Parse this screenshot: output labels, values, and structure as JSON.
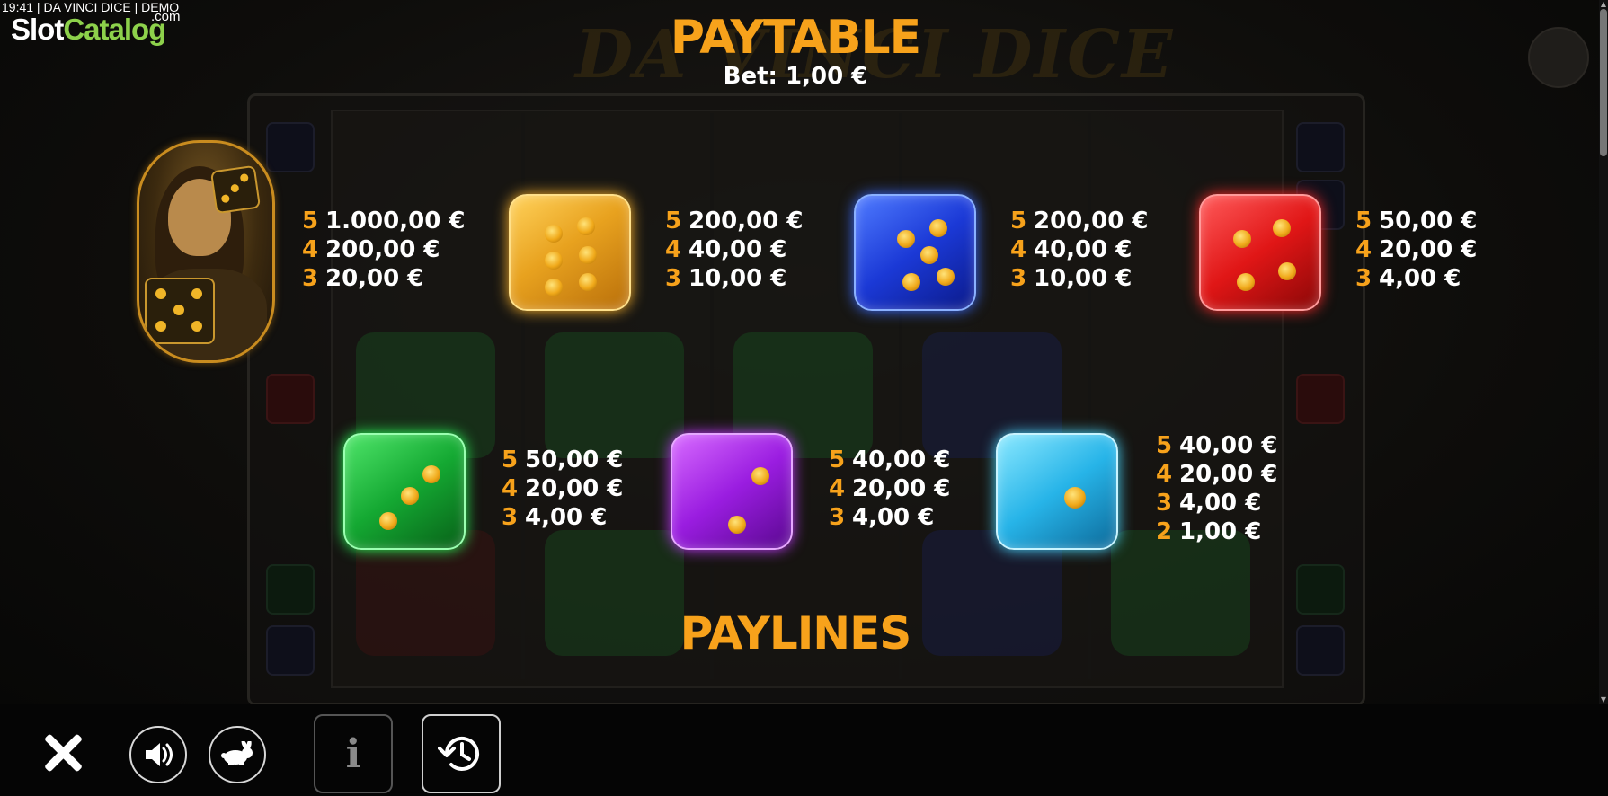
{
  "header": {
    "time": "19:41",
    "game": "DA VINCI DICE",
    "mode": "DEMO",
    "separator": " | "
  },
  "watermark": {
    "part1": "Slot",
    "part2": "Catalog",
    "suffix": ".com"
  },
  "paytable": {
    "title": "PAYTABLE",
    "bet_label": "Bet:",
    "bet_value": "1,00 €",
    "symbols": [
      {
        "name": "mona-lisa-wild",
        "pays": [
          {
            "count": "5",
            "amount": "1.000,00 €"
          },
          {
            "count": "4",
            "amount": "200,00 €"
          },
          {
            "count": "3",
            "amount": "20,00 €"
          }
        ]
      },
      {
        "name": "yellow-die",
        "color": "#f0a91a",
        "pays": [
          {
            "count": "5",
            "amount": "200,00 €"
          },
          {
            "count": "4",
            "amount": "40,00 €"
          },
          {
            "count": "3",
            "amount": "10,00 €"
          }
        ]
      },
      {
        "name": "blue-die",
        "color": "#1b39d6",
        "pays": [
          {
            "count": "5",
            "amount": "200,00 €"
          },
          {
            "count": "4",
            "amount": "40,00 €"
          },
          {
            "count": "3",
            "amount": "10,00 €"
          }
        ]
      },
      {
        "name": "red-die",
        "color": "#e01616",
        "pays": [
          {
            "count": "5",
            "amount": "50,00 €"
          },
          {
            "count": "4",
            "amount": "20,00 €"
          },
          {
            "count": "3",
            "amount": "4,00 €"
          }
        ]
      },
      {
        "name": "green-die",
        "color": "#14a832",
        "pays": [
          {
            "count": "5",
            "amount": "50,00 €"
          },
          {
            "count": "4",
            "amount": "20,00 €"
          },
          {
            "count": "3",
            "amount": "4,00 €"
          }
        ]
      },
      {
        "name": "purple-die",
        "color": "#9a1de0",
        "pays": [
          {
            "count": "5",
            "amount": "40,00 €"
          },
          {
            "count": "4",
            "amount": "20,00 €"
          },
          {
            "count": "3",
            "amount": "4,00 €"
          }
        ]
      },
      {
        "name": "cyan-die",
        "color": "#27b4e8",
        "pays": [
          {
            "count": "5",
            "amount": "40,00 €"
          },
          {
            "count": "4",
            "amount": "20,00 €"
          },
          {
            "count": "3",
            "amount": "4,00 €"
          },
          {
            "count": "2",
            "amount": "1,00 €"
          }
        ]
      }
    ]
  },
  "paylines": {
    "title": "PAYLINES"
  },
  "toolbar": {
    "close_icon": "close-icon",
    "sound_icon": "speaker-icon",
    "turbo_icon": "rabbit-icon",
    "info_label": "i",
    "history_icon": "history-icon"
  },
  "colors": {
    "accent": "#f7a21b",
    "text": "#ffffff",
    "background": "#0a0908"
  }
}
